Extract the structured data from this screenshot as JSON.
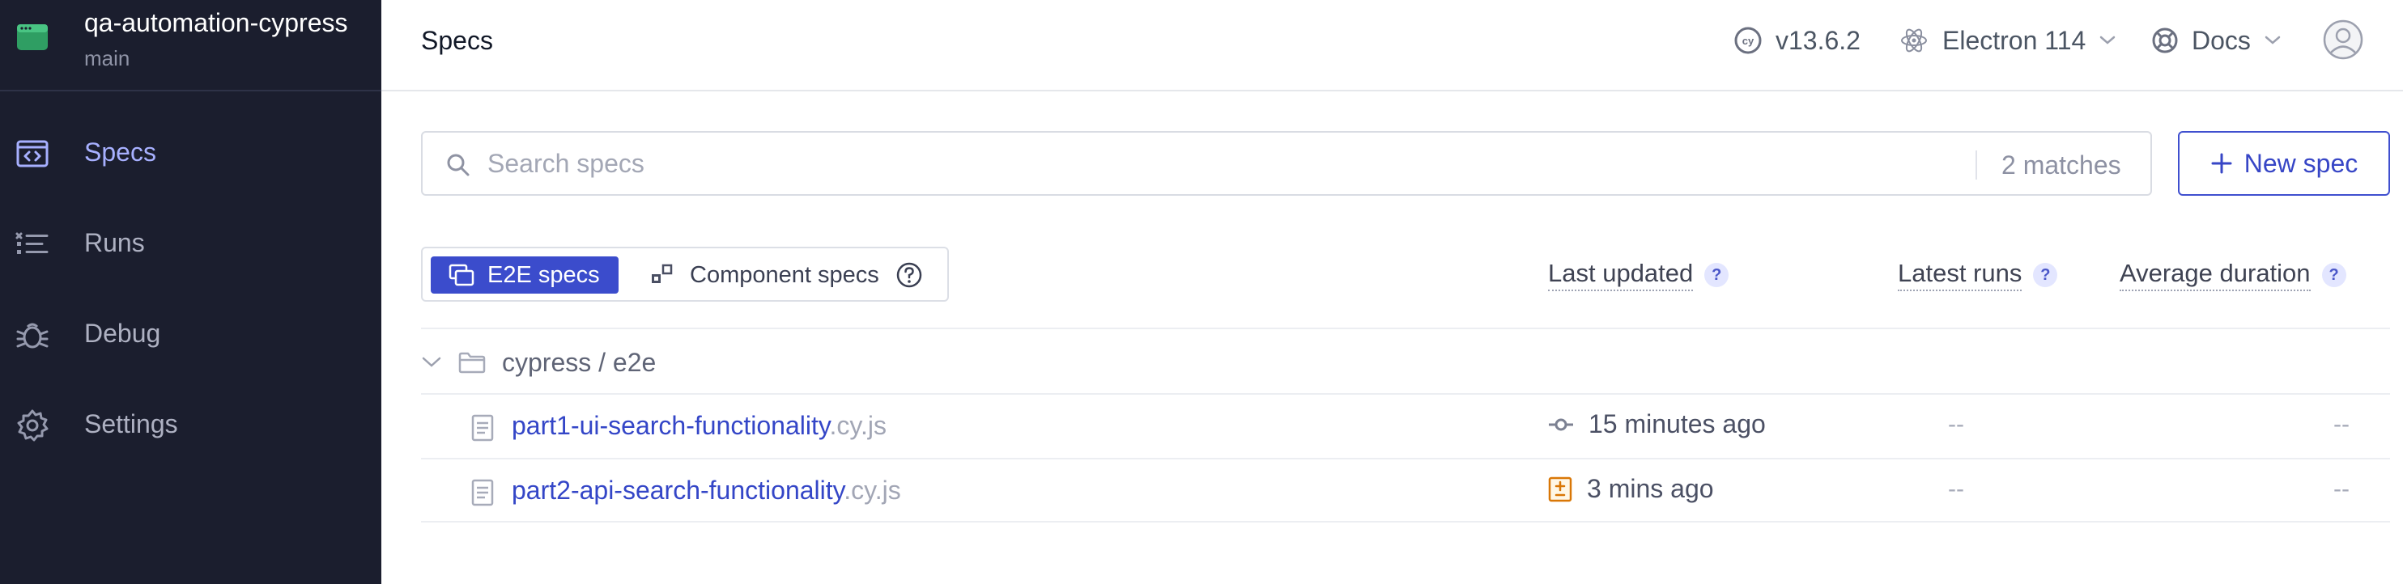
{
  "sidebar": {
    "project_name": "qa-automation-cypress",
    "branch": "main",
    "items": [
      {
        "label": "Specs",
        "icon": "specs-icon",
        "active": true
      },
      {
        "label": "Runs",
        "icon": "runs-icon",
        "active": false
      },
      {
        "label": "Debug",
        "icon": "bug-icon",
        "active": false
      },
      {
        "label": "Settings",
        "icon": "gear-icon",
        "active": false
      }
    ]
  },
  "topbar": {
    "title": "Specs",
    "version": "v13.6.2",
    "browser": "Electron 114",
    "docs": "Docs"
  },
  "search": {
    "placeholder": "Search specs",
    "value": "",
    "matches": "2 matches"
  },
  "new_spec_label": "New spec",
  "tabs": {
    "e2e": "E2E specs",
    "component": "Component specs"
  },
  "columns": {
    "last_updated": "Last updated",
    "latest_runs": "Latest runs",
    "average_duration": "Average duration",
    "help": "?"
  },
  "folder": "cypress / e2e",
  "specs": [
    {
      "name": "part1-ui-search-functionality",
      "ext": ".cy.js",
      "updated": "15 minutes ago",
      "updated_icon": "git-commit-icon",
      "latest_runs": "--",
      "avg_duration": "--"
    },
    {
      "name": "part2-api-search-functionality",
      "ext": ".cy.js",
      "updated": "3 mins ago",
      "updated_icon": "file-modified-icon",
      "latest_runs": "--",
      "avg_duration": "--"
    }
  ],
  "colors": {
    "sidebar_bg": "#1b1e2e",
    "accent": "#3b4ccc",
    "active_nav": "#a7b0ff",
    "modified": "#d97706"
  }
}
